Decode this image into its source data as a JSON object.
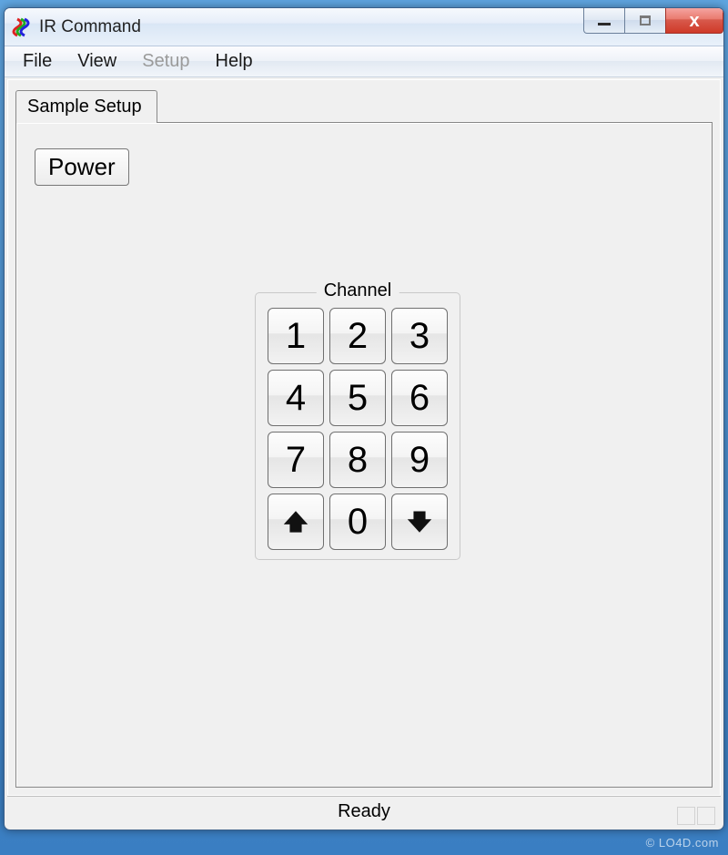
{
  "window": {
    "title": "IR Command"
  },
  "menu": {
    "file": "File",
    "view": "View",
    "setup": "Setup",
    "help": "Help"
  },
  "tab": {
    "label": "Sample Setup"
  },
  "remote": {
    "power_label": "Power",
    "channel_label": "Channel",
    "keys": {
      "k1": "1",
      "k2": "2",
      "k3": "3",
      "k4": "4",
      "k5": "5",
      "k6": "6",
      "k7": "7",
      "k8": "8",
      "k9": "9",
      "k0": "0"
    }
  },
  "status": {
    "text": "Ready"
  },
  "watermark": "© LO4D.com"
}
